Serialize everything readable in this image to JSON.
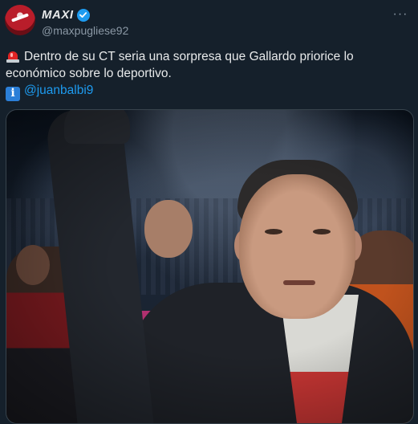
{
  "author": {
    "display_name": "MAXI",
    "handle": "@maxpugliese92"
  },
  "tweet": {
    "text": "Dentro de su CT seria una sorpresa que Gallardo priorice lo económico sobre lo deportivo.",
    "source_mention": "@juanbalbi9"
  },
  "icons": {
    "verified": "verified-badge-icon",
    "more": "more-options-icon",
    "siren": "police-siren-icon",
    "info": "information-icon"
  },
  "colors": {
    "background": "#15202b",
    "accent": "#1d9bf0",
    "muted": "#8b98a5"
  }
}
